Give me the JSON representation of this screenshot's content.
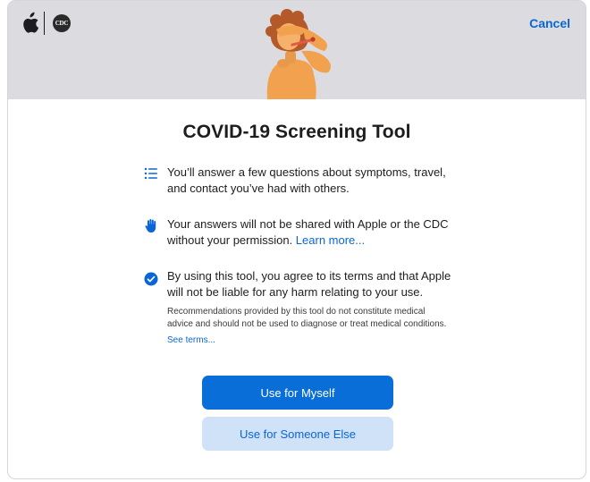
{
  "header": {
    "cdc_logo_text": "CDC",
    "cancel_label": "Cancel",
    "apple_logo_icon": "apple-logo-icon",
    "illustration": "person-with-thermometer-illustration"
  },
  "title": "COVID-19 Screening Tool",
  "items": [
    {
      "icon": "list-icon",
      "text": "You’ll answer a few questions about symptoms, travel, and contact you’ve had with others."
    },
    {
      "icon": "hand-icon",
      "text": "Your answers will not be shared with Apple or the CDC without your permission.",
      "link": "Learn more..."
    },
    {
      "icon": "checkmark-circle-icon",
      "text": "By using this tool, you agree to its terms and that Apple will not be liable for any harm relating to your use.",
      "fine_print": "Recommendations provided by this tool do not constitute medical advice and should not be used to diagnose or treat medical conditions.",
      "link": "See terms..."
    }
  ],
  "buttons": {
    "primary": "Use for Myself",
    "secondary": "Use for Someone Else"
  },
  "colors": {
    "accent": "#0a6ed8",
    "header_bg": "#dcdce0",
    "secondary_button_bg": "#cfe2f8",
    "illustration_skin": "#f2a14f",
    "illustration_hair": "#b45a2a"
  }
}
